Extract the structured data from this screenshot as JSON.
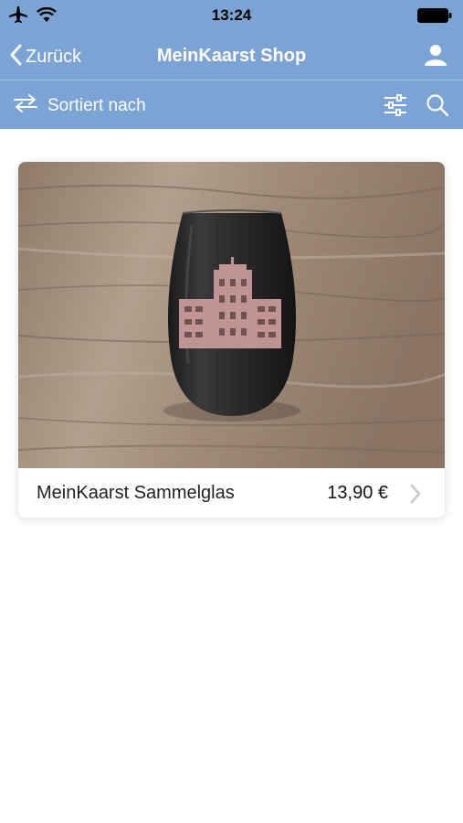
{
  "status": {
    "time": "13:24"
  },
  "nav": {
    "back_label": "Zurück",
    "title": "MeinKaarst Shop"
  },
  "filter": {
    "sort_label": "Sortiert nach"
  },
  "products": [
    {
      "name": "MeinKaarst Sammelglas",
      "price": "13,90 €"
    }
  ],
  "colors": {
    "header": "#7ba3d4",
    "background": "#ffffff"
  },
  "icons": [
    "airplane-icon",
    "wifi-icon",
    "battery-icon",
    "chevron-left-icon",
    "user-icon",
    "swap-arrows-icon",
    "sliders-icon",
    "search-icon",
    "chevron-right-icon"
  ]
}
